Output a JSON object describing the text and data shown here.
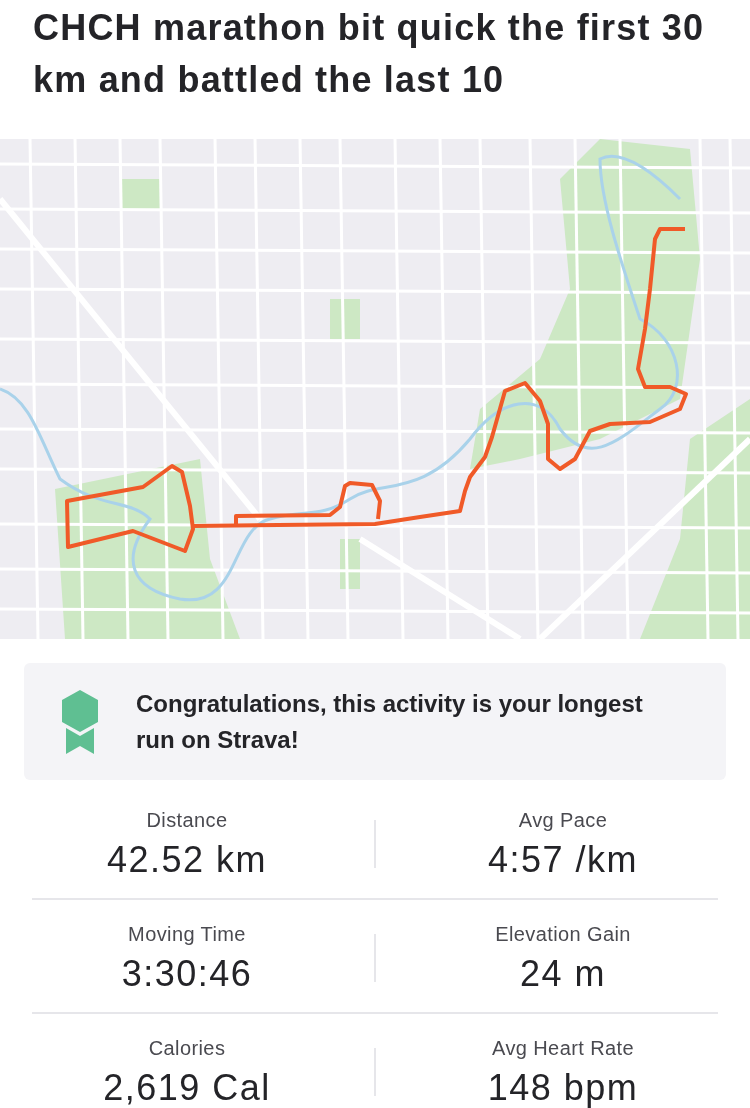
{
  "title": "CHCH marathon bit quick the first 30 km and battled the last 10",
  "achievement": {
    "text": "Congratulations, this activity is your longest run on Strava!"
  },
  "stats": [
    {
      "label": "Distance",
      "value": "42.52 km"
    },
    {
      "label": "Avg Pace",
      "value": "4:57 /km"
    },
    {
      "label": "Moving Time",
      "value": "3:30:46"
    },
    {
      "label": "Elevation Gain",
      "value": "24 m"
    },
    {
      "label": "Calories",
      "value": "2,619 Cal"
    },
    {
      "label": "Avg Heart Rate",
      "value": "148 bpm"
    }
  ]
}
